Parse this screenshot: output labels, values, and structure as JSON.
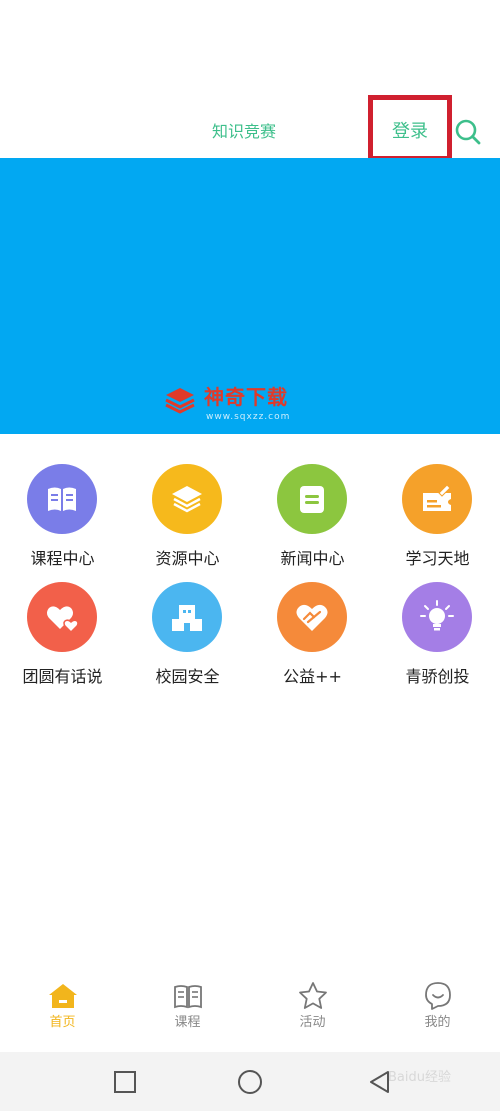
{
  "header": {
    "tab_label": "知识竞赛",
    "login_label": "登录",
    "accent_color": "#3dbf8b",
    "highlight_color": "#d0202f"
  },
  "banner": {
    "color": "#02a8f2",
    "watermark_title": "神奇下载",
    "watermark_url": "www.sqxzz.com"
  },
  "grid": {
    "items": [
      {
        "label": "课程中心",
        "icon": "open-book-icon",
        "color": "#7a7de8"
      },
      {
        "label": "资源中心",
        "icon": "layers-icon",
        "color": "#f6b91c"
      },
      {
        "label": "新闻中心",
        "icon": "news-doc-icon",
        "color": "#8cc63f"
      },
      {
        "label": "学习天地",
        "icon": "ticket-pen-icon",
        "color": "#f5a12a"
      },
      {
        "label": "团圆有话说",
        "icon": "hearts-icon",
        "color": "#f2604a"
      },
      {
        "label": "校园安全",
        "icon": "school-building-icon",
        "color": "#4bb6f0"
      },
      {
        "label": "公益++",
        "icon": "heart-handshake-icon",
        "color": "#f58a3a"
      },
      {
        "label": "青骄创投",
        "icon": "lightbulb-icon",
        "color": "#a47ee6"
      }
    ]
  },
  "bottom_nav": {
    "items": [
      {
        "label": "首页",
        "icon": "home-icon",
        "active": true
      },
      {
        "label": "课程",
        "icon": "book-icon",
        "active": false
      },
      {
        "label": "活动",
        "icon": "star-icon",
        "active": false
      },
      {
        "label": "我的",
        "icon": "smile-chat-icon",
        "active": false
      }
    ],
    "active_color": "#f2b51c",
    "inactive_color": "#888888"
  },
  "system_bar": {
    "buttons": [
      "recents-square-icon",
      "home-circle-icon",
      "back-triangle-icon"
    ],
    "watermark": "Baidu经验"
  }
}
